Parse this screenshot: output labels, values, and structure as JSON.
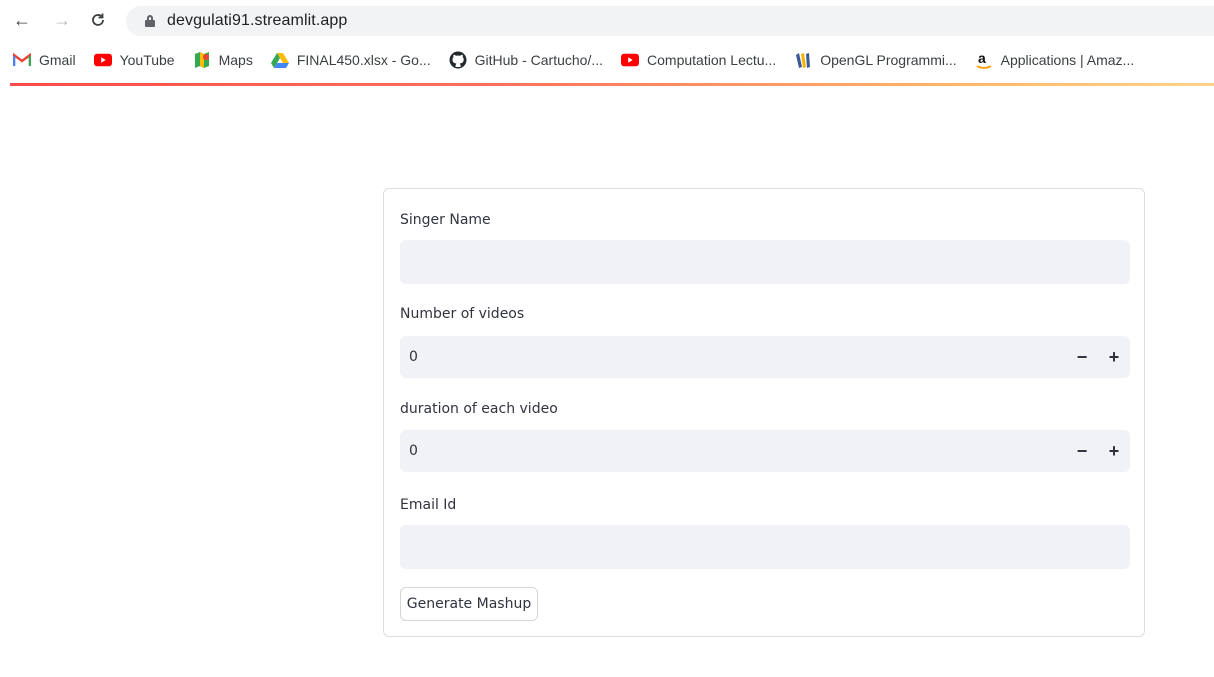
{
  "browser": {
    "url": "devgulati91.streamlit.app",
    "bookmarks": [
      {
        "label": "Gmail",
        "icon": "gmail-icon"
      },
      {
        "label": "YouTube",
        "icon": "youtube-icon"
      },
      {
        "label": "Maps",
        "icon": "maps-icon"
      },
      {
        "label": "FINAL450.xlsx - Go...",
        "icon": "google-drive-icon"
      },
      {
        "label": "GitHub - Cartucho/...",
        "icon": "github-icon"
      },
      {
        "label": "Computation Lectu...",
        "icon": "youtube-icon"
      },
      {
        "label": "OpenGL Programmi...",
        "icon": "books-icon"
      },
      {
        "label": "Applications | Amaz...",
        "icon": "amazon-icon"
      }
    ]
  },
  "form": {
    "singer_label": "Singer Name",
    "singer_value": "",
    "videos_label": "Number of videos",
    "videos_value": "0",
    "duration_label": "duration of each video",
    "duration_value": "0",
    "email_label": "Email Id",
    "email_value": "",
    "minus": "−",
    "plus": "+",
    "submit_label": "Generate Mashup"
  },
  "colors": {
    "accent": "#ff4b4b",
    "input_bg": "#f0f2f6",
    "text": "#31333f"
  }
}
